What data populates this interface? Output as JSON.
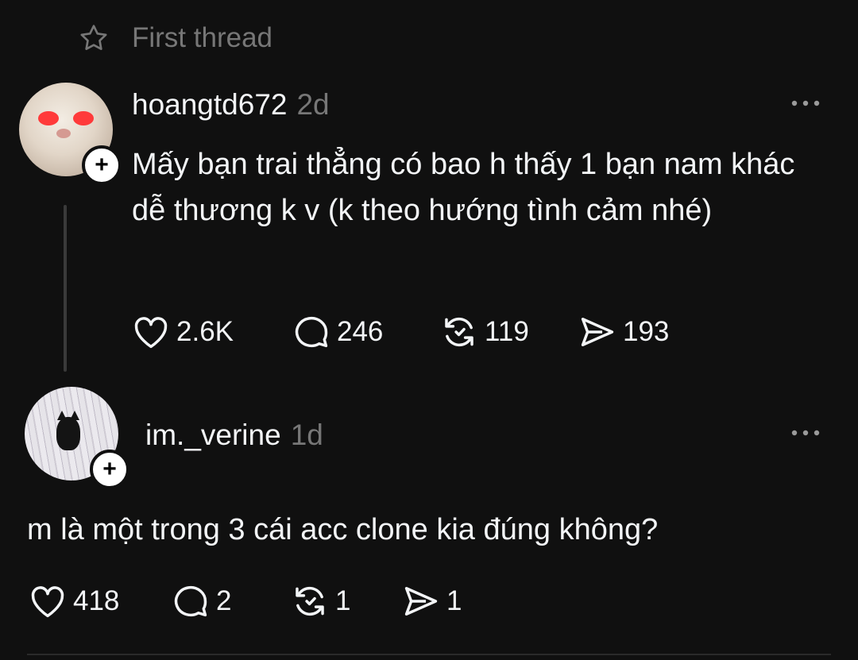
{
  "header": {
    "label": "First thread"
  },
  "post": {
    "username": "hoangtd672",
    "time": "2d",
    "text": "Mấy bạn trai thẳng có bao h thấy 1 bạn nam khác dễ thương k v (k theo hướng tình cảm nhé)",
    "follow_symbol": "+",
    "stats": {
      "likes": "2.6K",
      "replies": "246",
      "reposts": "119",
      "shares": "193"
    }
  },
  "reply": {
    "username": "im._verine",
    "time": "1d",
    "text": "m là một trong 3 cái acc clone kia đúng không?",
    "follow_symbol": "+",
    "stats": {
      "likes": "418",
      "replies": "2",
      "reposts": "1",
      "shares": "1"
    }
  },
  "icons": [
    "star-icon",
    "more-icon",
    "heart-icon",
    "comment-icon",
    "repost-icon",
    "share-icon",
    "plus-icon"
  ],
  "colors": {
    "background": "#101010",
    "text": "#f3f5f7",
    "muted": "#777777"
  }
}
